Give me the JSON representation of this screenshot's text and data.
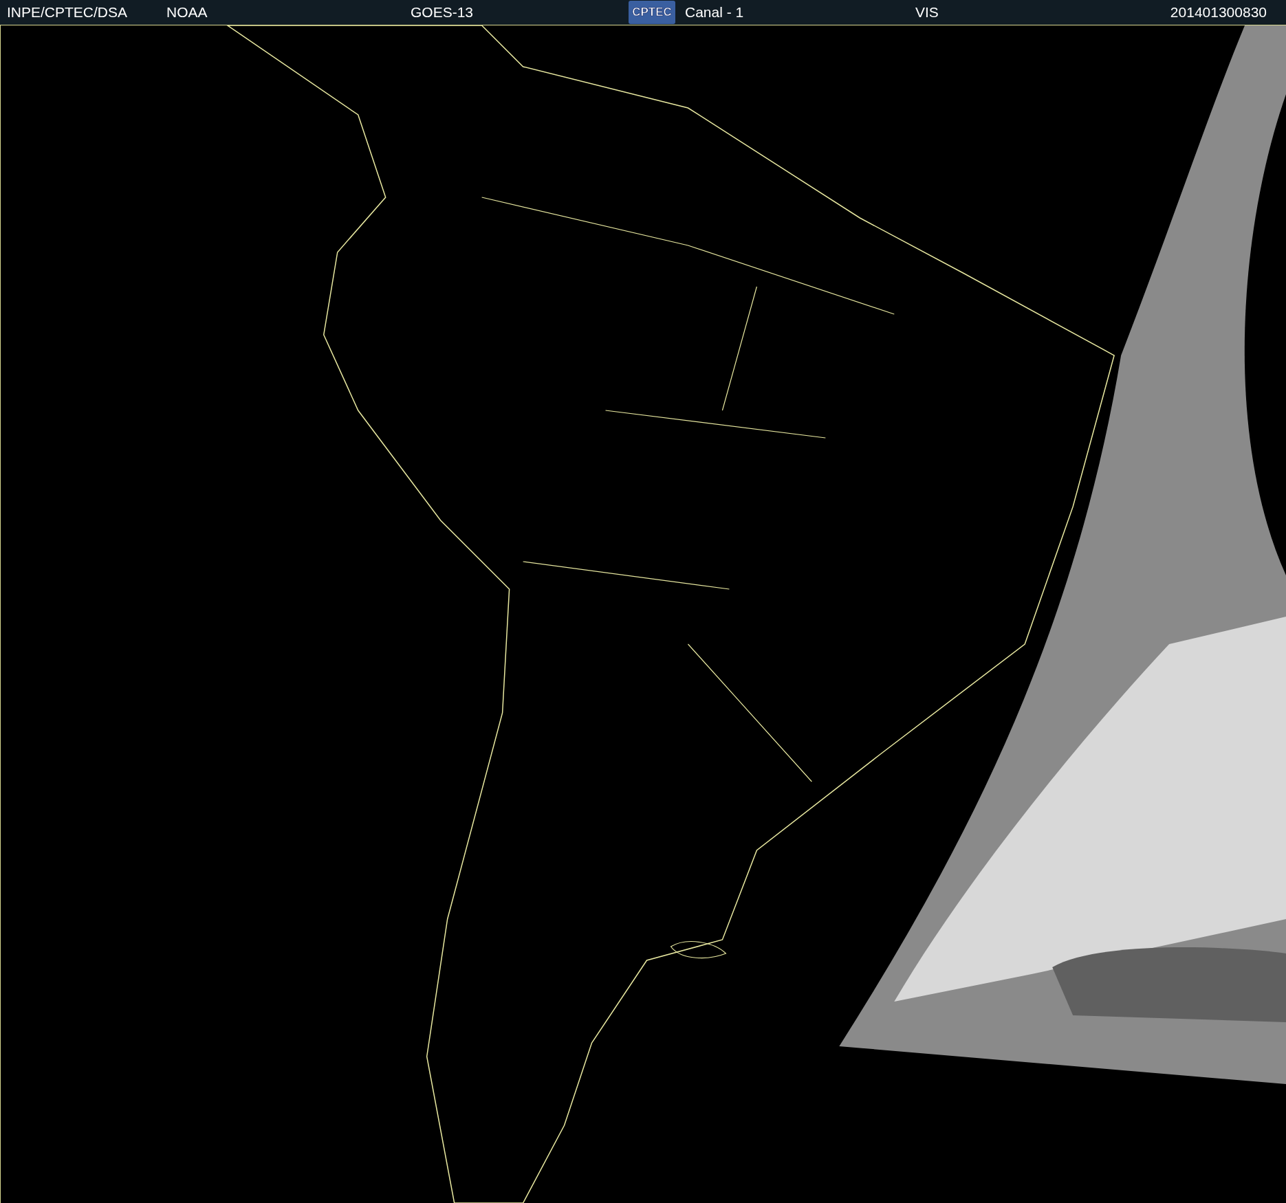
{
  "header": {
    "items": [
      {
        "kind": "text",
        "text": "INPE/CPTEC/DSA"
      },
      {
        "kind": "text",
        "text": "NOAA"
      },
      {
        "kind": "text",
        "text": "GOES-13"
      },
      {
        "kind": "logo",
        "text": "CPTEC"
      },
      {
        "kind": "text",
        "text": "Canal - 1"
      },
      {
        "kind": "text",
        "text": "VIS"
      },
      {
        "kind": "text",
        "text": "201401300830"
      }
    ]
  }
}
